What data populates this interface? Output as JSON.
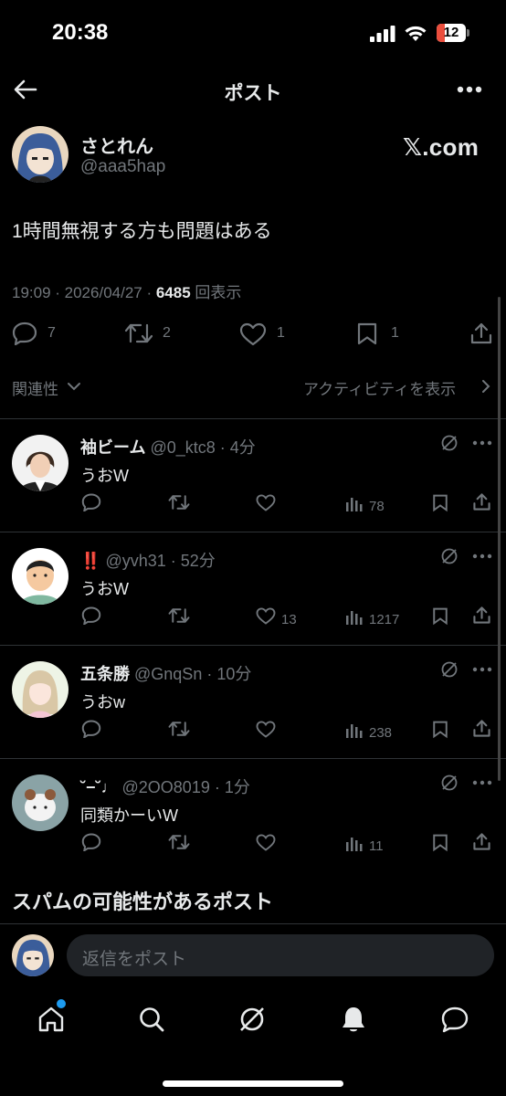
{
  "status_bar": {
    "time": "20:38",
    "battery": "12"
  },
  "header": {
    "title": "ポスト"
  },
  "post": {
    "author_name": "さとれん",
    "author_handle": "@aaa5hap",
    "source_label": "𝕏.com",
    "text": "1時間無視する方も問題はある",
    "time": "19:09 · 2026/04/27 · ",
    "views": "6485",
    "views_suffix": "回表示",
    "replies": "7",
    "reposts": "2",
    "likes": "1",
    "bookmarks": "1"
  },
  "sort": {
    "label": "関連性",
    "activity_label": "アクティビティを表示"
  },
  "replies": [
    {
      "name": "袖ビーム",
      "handle": "@0_ktc8 · 4分",
      "text": "うおW",
      "likes": "",
      "views": "78"
    },
    {
      "name": "‼️",
      "handle": "@yvh31 · 52分",
      "text": "うおW",
      "likes": "13",
      "views": "1217"
    },
    {
      "name": "五条勝",
      "handle": "@GnqSn · 10分",
      "text": "うおw",
      "likes": "",
      "views": "238"
    },
    {
      "name": "˘−˘♩",
      "handle": "@2OO8019 · 1分",
      "text": "同類かーいW",
      "likes": "",
      "views": "11"
    }
  ],
  "spam_section": {
    "title": "スパムの可能性があるポスト"
  },
  "reply_box": {
    "placeholder": "返信をポスト"
  },
  "colors": {
    "background": "#000000",
    "text": "#e7e9ea",
    "muted": "#71767b",
    "accent": "#1d9bf0",
    "divider": "#2f3336"
  }
}
